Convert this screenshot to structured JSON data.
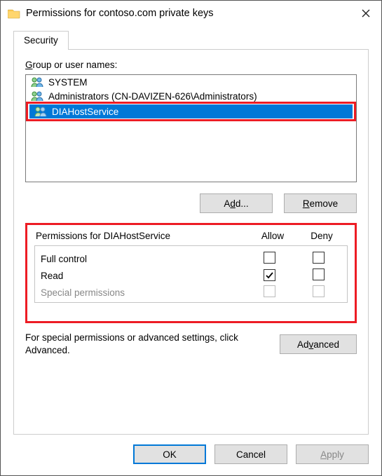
{
  "window": {
    "title": "Permissions for contoso.com private keys"
  },
  "tabs": {
    "security": "Security"
  },
  "labels": {
    "group_users_prefix": "G",
    "group_users_rest": "roup or user names:",
    "perm_for_prefix": "Permissions for ",
    "perm_for_target": "DIAHostService",
    "allow": "Allow",
    "deny": "Deny",
    "advanced_hint": "For special permissions or advanced settings, click Advanced."
  },
  "principals": [
    {
      "label": "SYSTEM",
      "selected": false
    },
    {
      "label": "Administrators (CN-DAVIZEN-626\\Administrators)",
      "selected": false
    },
    {
      "label": "DIAHostService",
      "selected": true
    }
  ],
  "buttons": {
    "add_prefix": "A",
    "add_u": "d",
    "add_suffix": "d...",
    "remove_u": "R",
    "remove_rest": "emove",
    "advanced_pre": "Ad",
    "advanced_u": "v",
    "advanced_post": "anced",
    "ok": "OK",
    "cancel": "Cancel",
    "apply_u": "A",
    "apply_rest": "pply"
  },
  "permissions": [
    {
      "name": "Full control",
      "allow": false,
      "deny": false,
      "enabled": true
    },
    {
      "name": "Read",
      "allow": true,
      "deny": false,
      "enabled": true
    },
    {
      "name": "Special permissions",
      "allow": false,
      "deny": false,
      "enabled": false
    }
  ]
}
